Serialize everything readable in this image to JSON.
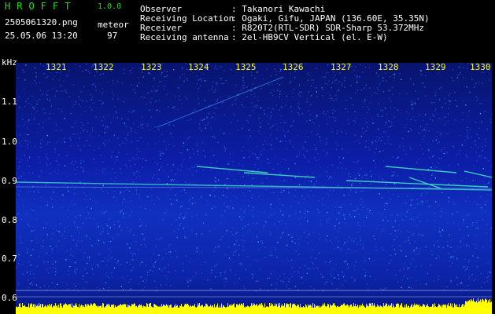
{
  "header": {
    "brand": "HROFFT",
    "version": "1.0.0",
    "filename": "2505061320.png",
    "datetime": "25.05.06 13:20",
    "type_label": "meteor",
    "count": "97"
  },
  "info": [
    {
      "label": "Observer",
      "value": ": Takanori Kawachi"
    },
    {
      "label": "Receiving Location",
      "value": ": Ogaki, Gifu, JAPAN (136.60E, 35.35N)"
    },
    {
      "label": "Receiver",
      "value": ": R820T2(RTL-SDR) SDR-Sharp 53.372MHz"
    },
    {
      "label": "Receiving antenna",
      "value": ": 2el-HB9CV Vertical (el. E-W)"
    }
  ],
  "axes": {
    "y_unit": "kHz",
    "y_ticks": [
      "1.1",
      "1.0",
      "0.9",
      "0.8",
      "0.7",
      "0.6"
    ],
    "x_ticks": [
      "1321",
      "1322",
      "1323",
      "1324",
      "1325",
      "1326",
      "1327",
      "1328",
      "1329",
      "1330"
    ]
  },
  "colors": {
    "background": "#000000",
    "spectrogram_base": "#0a1aa0",
    "meteor_echo": "#19e6a0",
    "signal_yellow": "#ffff00",
    "text_green": "#19e619"
  }
}
